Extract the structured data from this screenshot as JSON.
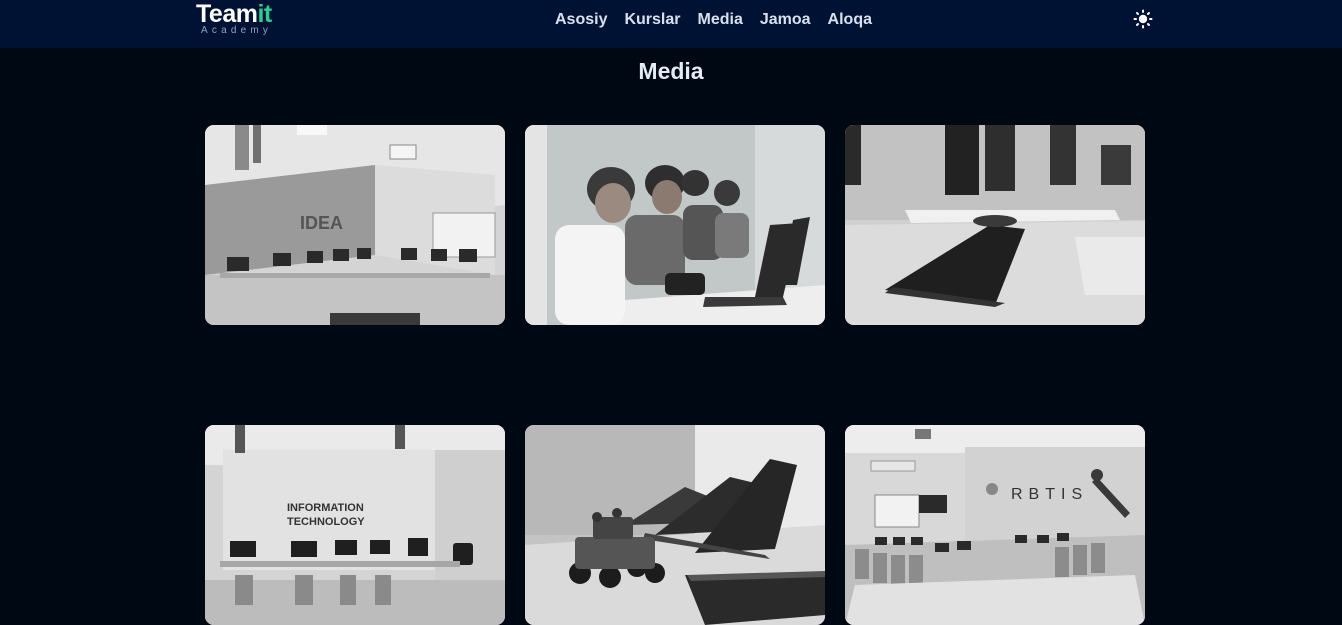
{
  "navbar": {
    "logo": {
      "main": "Team",
      "accent": "it",
      "sub": "Academy"
    },
    "links": [
      {
        "label": "Asosiy"
      },
      {
        "label": "Kurslar"
      },
      {
        "label": "Media"
      },
      {
        "label": "Jamoa"
      },
      {
        "label": "Aloqa"
      }
    ],
    "theme_toggle_icon": "sun-icon"
  },
  "page": {
    "title": "Media"
  },
  "gallery": {
    "items": [
      {
        "scene": "classroom-idea",
        "wall_text": "IDEA"
      },
      {
        "scene": "students-laptops"
      },
      {
        "scene": "keyboard-closeup"
      },
      {
        "scene": "classroom-it",
        "wall_text_1": "INFORMATION",
        "wall_text_2": "TECHNOLOGY"
      },
      {
        "scene": "robot-car"
      },
      {
        "scene": "classroom-robotics",
        "wall_text": "RBTIS"
      }
    ]
  },
  "colors": {
    "background": "#000814",
    "navbar": "#001233",
    "accent": "#2ecc8f",
    "nav_text": "#d8e0ee"
  }
}
